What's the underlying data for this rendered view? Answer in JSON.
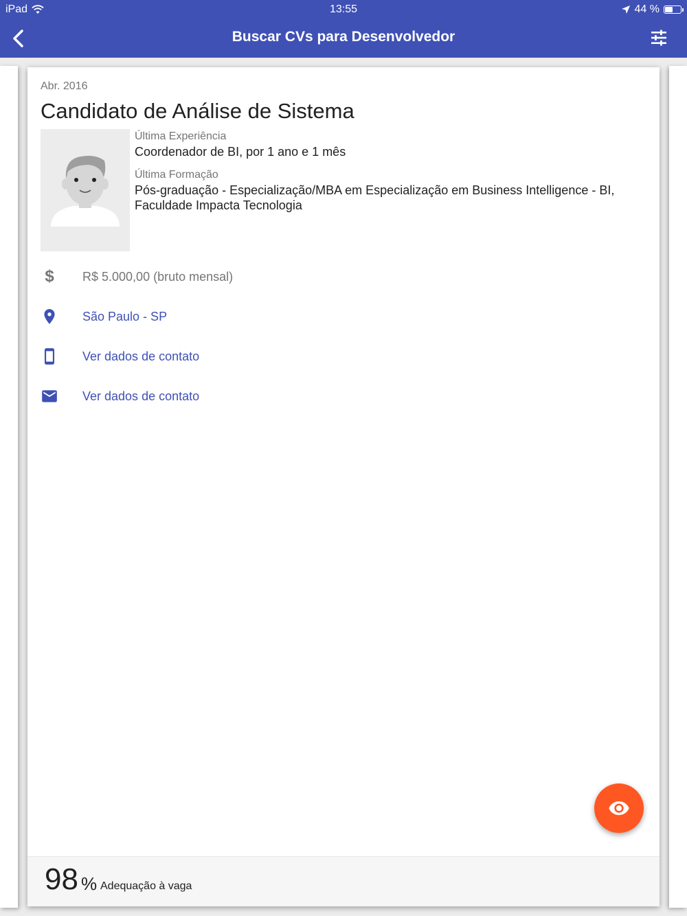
{
  "status_bar": {
    "device": "iPad",
    "time": "13:55",
    "battery": "44 %",
    "battery_level": 0.44
  },
  "nav": {
    "title": "Buscar CVs para Desenvolvedor",
    "back_icon": "chevron-left-icon",
    "filter_icon": "sliders-icon"
  },
  "card": {
    "date": "Abr. 2016",
    "title": "Candidato de Análise de Sistema",
    "last_experience_label": "Última Experiência",
    "last_experience_value": "Coordenador de BI, por 1 ano e 1 mês",
    "last_education_label": "Última Formação",
    "last_education_line1": "Pós-graduação - Especialização/MBA em Especialização em Business Intelligence - BI,",
    "last_education_line2": "Faculdade Impacta Tecnologia",
    "salary": "R$ 5.000,00 (bruto mensal)",
    "location": "São Paulo - SP",
    "phone": "Ver dados de contato",
    "email": "Ver dados de contato"
  },
  "footer": {
    "match_value": "98",
    "match_sign": "%",
    "match_label": "Adequação à vaga"
  },
  "colors": {
    "primary": "#3f51b5",
    "accent": "#ff5722"
  }
}
